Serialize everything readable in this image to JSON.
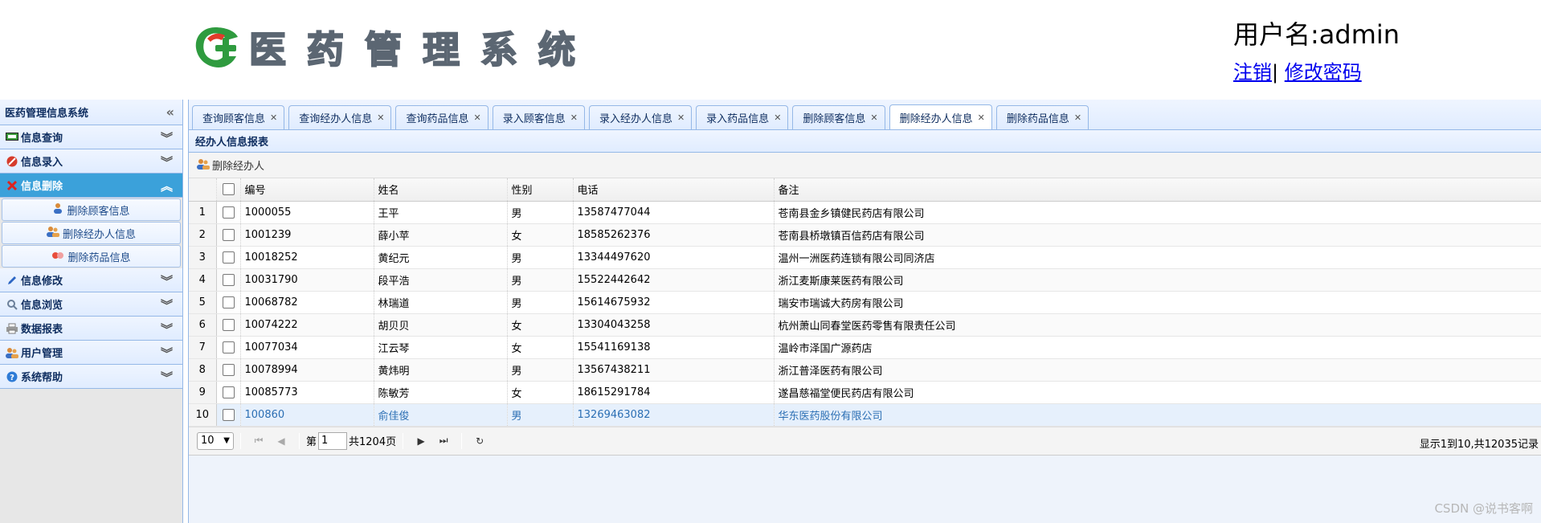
{
  "header": {
    "logo_text": "医药管理系统",
    "user_label": "用户名:admin",
    "logout_link": "注销",
    "separator": "|",
    "change_password_link": "修改密码"
  },
  "sidebar": {
    "title": "医药管理信息系统",
    "sections": [
      {
        "label": "信息查询",
        "icon": "monitor-icon"
      },
      {
        "label": "信息录入",
        "icon": "no-entry-icon"
      },
      {
        "label": "信息删除",
        "icon": "red-x-icon",
        "active": true
      },
      {
        "label": "信息修改",
        "icon": "pencil-icon"
      },
      {
        "label": "信息浏览",
        "icon": "magnifier-icon"
      },
      {
        "label": "数据报表",
        "icon": "printer-icon"
      },
      {
        "label": "用户管理",
        "icon": "users-icon"
      },
      {
        "label": "系统帮助",
        "icon": "help-icon"
      }
    ],
    "sub_items": [
      {
        "label": "删除顾客信息",
        "icon": "user-icon"
      },
      {
        "label": "删除经办人信息",
        "icon": "users-icon"
      },
      {
        "label": "删除药品信息",
        "icon": "pills-icon"
      }
    ]
  },
  "tabs": [
    {
      "label": "查询顾客信息"
    },
    {
      "label": "查询经办人信息"
    },
    {
      "label": "查询药品信息"
    },
    {
      "label": "录入顾客信息"
    },
    {
      "label": "录入经办人信息"
    },
    {
      "label": "录入药品信息"
    },
    {
      "label": "删除顾客信息"
    },
    {
      "label": "删除经办人信息",
      "selected": true
    },
    {
      "label": "删除药品信息"
    }
  ],
  "panel": {
    "title": "经办人信息报表",
    "toolbar_button": "删除经办人",
    "columns": [
      "编号",
      "姓名",
      "性别",
      "电话",
      "备注"
    ],
    "rows": [
      {
        "n": "1",
        "id": "1000055",
        "name": "王平",
        "sex": "男",
        "phone": "13587477044",
        "note": "苍南县金乡镇健民药店有限公司"
      },
      {
        "n": "2",
        "id": "1001239",
        "name": "薛小苹",
        "sex": "女",
        "phone": "18585262376",
        "note": "苍南县桥墩镇百信药店有限公司"
      },
      {
        "n": "3",
        "id": "10018252",
        "name": "黄纪元",
        "sex": "男",
        "phone": "13344497620",
        "note": "温州一洲医药连锁有限公司同济店"
      },
      {
        "n": "4",
        "id": "10031790",
        "name": "段平浩",
        "sex": "男",
        "phone": "15522442642",
        "note": "浙江麦斯康莱医药有限公司"
      },
      {
        "n": "5",
        "id": "10068782",
        "name": "林瑞道",
        "sex": "男",
        "phone": "15614675932",
        "note": "瑞安市瑞诚大药房有限公司"
      },
      {
        "n": "6",
        "id": "10074222",
        "name": "胡贝贝",
        "sex": "女",
        "phone": "13304043258",
        "note": "杭州萧山同春堂医药零售有限责任公司"
      },
      {
        "n": "7",
        "id": "10077034",
        "name": "江云琴",
        "sex": "女",
        "phone": "15541169138",
        "note": "温岭市泽国广源药店"
      },
      {
        "n": "8",
        "id": "10078994",
        "name": "黄炜明",
        "sex": "男",
        "phone": "13567438211",
        "note": "浙江普泽医药有限公司"
      },
      {
        "n": "9",
        "id": "10085773",
        "name": "陈敏芳",
        "sex": "女",
        "phone": "18615291784",
        "note": "遂昌慈福堂便民药店有限公司"
      },
      {
        "n": "10",
        "id": "100860",
        "name": "俞佳俊",
        "sex": "男",
        "phone": "13269463082",
        "note": "华东医药股份有限公司"
      }
    ]
  },
  "pager": {
    "page_size": "10",
    "page_prefix": "第",
    "page_value": "1",
    "page_total": "共1204页",
    "info": "显示1到10,共12035记录"
  },
  "watermark": "CSDN @说书客啊"
}
